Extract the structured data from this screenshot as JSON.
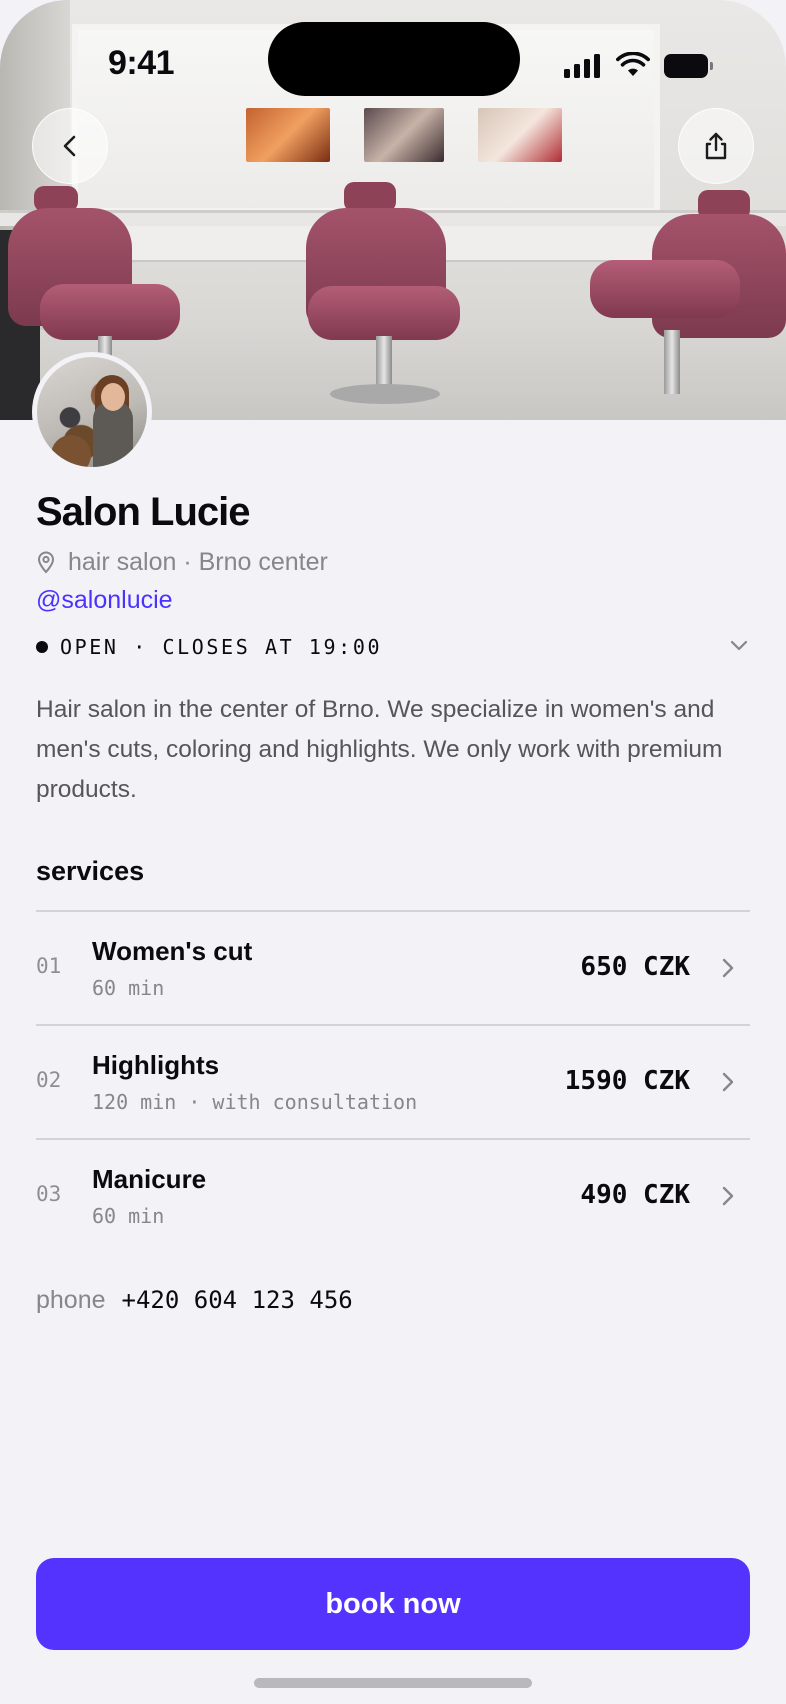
{
  "status_bar": {
    "time": "9:41"
  },
  "header": {
    "back_icon": "chevron-left-icon",
    "share_icon": "share-icon"
  },
  "salon": {
    "name": "Salon Lucie",
    "location": "hair salon · Brno center",
    "handle": "@salonlucie",
    "hours_status": "OPEN · CLOSES AT 19:00",
    "description": "Hair salon in the center of Brno. We specialize in women's and men's cuts, coloring and highlights. We only work with premium products."
  },
  "services": {
    "heading": "services",
    "items": [
      {
        "num": "01",
        "name": "Women's cut",
        "details": "60 min",
        "price": "650 CZK"
      },
      {
        "num": "02",
        "name": "Highlights",
        "details": "120 min · with consultation",
        "price": "1590 CZK"
      },
      {
        "num": "03",
        "name": "Manicure",
        "details": "60 min",
        "price": "490 CZK"
      }
    ]
  },
  "contact": {
    "label": "phone",
    "value": "+420 604 123 456"
  },
  "cta": {
    "label": "book now"
  },
  "colors": {
    "accent": "#5533ff",
    "handle": "#4a33ff",
    "background": "#f2f2f7",
    "chair": "#9b4a62"
  }
}
